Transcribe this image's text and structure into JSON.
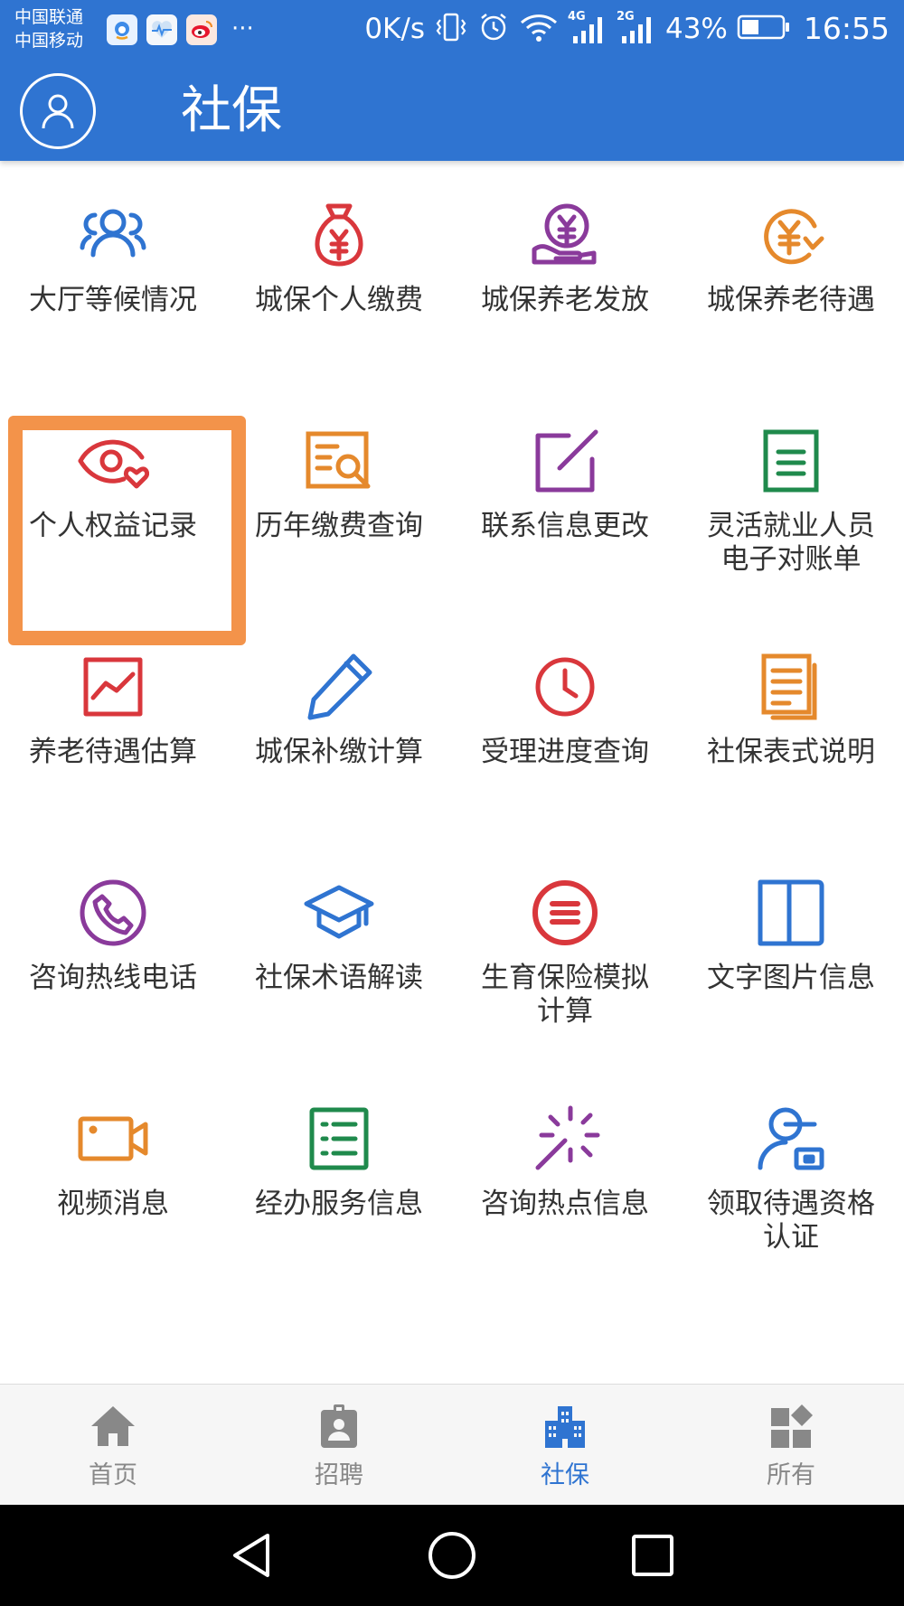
{
  "status_bar": {
    "carrier_1": "中国联通",
    "carrier_2": "中国移动",
    "notification_icons": [
      "qq-icon",
      "health-icon",
      "weibo-icon"
    ],
    "more": "···",
    "net_speed": "0K/s",
    "signal_1_tag": "4G",
    "signal_2_tag": "2G",
    "battery_percent": "43%",
    "battery_level": 0.43,
    "time": "16:55"
  },
  "header": {
    "title": "社保",
    "avatar_icon": "user-icon",
    "background_color": "#2f74d1"
  },
  "grid": {
    "items": [
      {
        "label": "大厅等候情况",
        "icon": "people-group-icon",
        "color": "#2f74d1"
      },
      {
        "label": "城保个人缴费",
        "icon": "money-bag-icon",
        "color": "#d9373c"
      },
      {
        "label": "城保养老发放",
        "icon": "hand-yen-icon",
        "color": "#8a3a9b"
      },
      {
        "label": "城保养老待遇",
        "icon": "yen-refresh-icon",
        "color": "#e5892c"
      },
      {
        "label": "个人权益记录",
        "icon": "eye-heart-icon",
        "color": "#d9373c",
        "highlighted": true
      },
      {
        "label": "历年缴费查询",
        "icon": "document-search-icon",
        "color": "#e5892c"
      },
      {
        "label": "联系信息更改",
        "icon": "edit-square-icon",
        "color": "#8a3a9b"
      },
      {
        "label": "灵活就业人员",
        "label_line2": "电子对账单",
        "icon": "document-lines-icon",
        "color": "#1f8a4c"
      },
      {
        "label": "养老待遇估算",
        "icon": "line-chart-icon",
        "color": "#d9373c"
      },
      {
        "label": "城保补缴计算",
        "icon": "pencil-icon",
        "color": "#2f74d1"
      },
      {
        "label": "受理进度查询",
        "icon": "clock-icon",
        "color": "#d9373c"
      },
      {
        "label": "社保表式说明",
        "icon": "documents-icon",
        "color": "#e5892c"
      },
      {
        "label": "咨询热线电话",
        "icon": "phone-icon",
        "color": "#8a3a9b"
      },
      {
        "label": "社保术语解读",
        "icon": "graduation-cap-icon",
        "color": "#2f74d1"
      },
      {
        "label": "生育保险模拟",
        "label_line2": "计算",
        "icon": "menu-circle-icon",
        "color": "#d9373c"
      },
      {
        "label": "文字图片信息",
        "icon": "book-open-icon",
        "color": "#2f74d1"
      },
      {
        "label": "视频消息",
        "icon": "video-camera-icon",
        "color": "#e5892c"
      },
      {
        "label": "经办服务信息",
        "icon": "list-icon",
        "color": "#1f8a4c"
      },
      {
        "label": "咨询热点信息",
        "icon": "sparkle-wand-icon",
        "color": "#8a3a9b"
      },
      {
        "label": "领取待遇资格",
        "label_line2": "认证",
        "icon": "person-card-icon",
        "color": "#2f74d1"
      }
    ]
  },
  "highlight_color": "#f3934a",
  "bottom_nav": {
    "items": [
      {
        "label": "首页",
        "icon": "home-icon"
      },
      {
        "label": "招聘",
        "icon": "badge-icon"
      },
      {
        "label": "社保",
        "icon": "buildings-icon",
        "active": true
      },
      {
        "label": "所有",
        "icon": "widgets-icon"
      }
    ],
    "active_color": "#2f74d1",
    "inactive_color": "#888888"
  },
  "system_nav": {
    "buttons": [
      "back-icon",
      "home-circle-icon",
      "recents-icon"
    ]
  }
}
